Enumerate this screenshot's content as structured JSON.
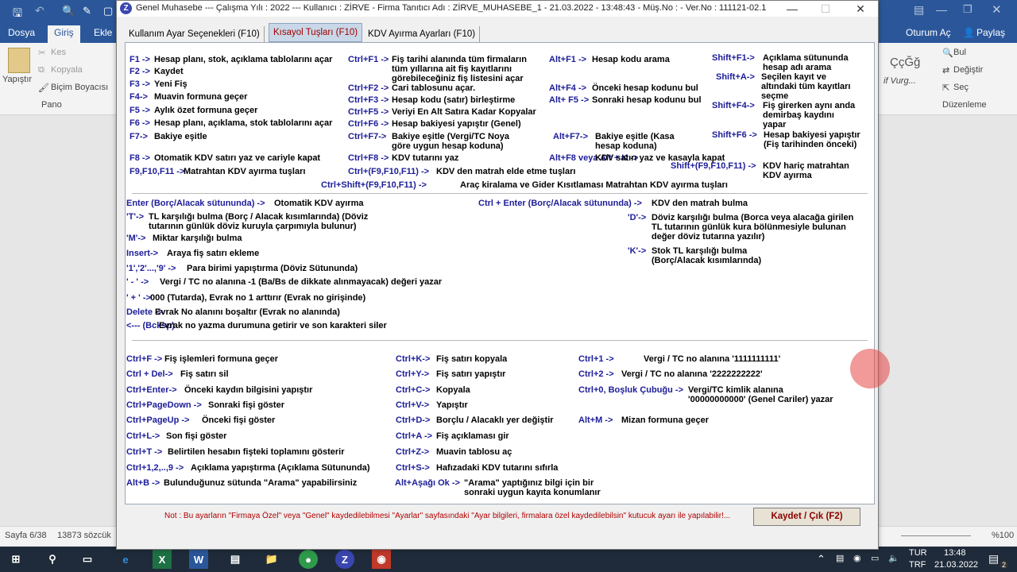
{
  "word": {
    "tabs": [
      "Dosya",
      "Giriş",
      "Ekle"
    ],
    "right_tabs": [
      "Oturum Aç",
      "Paylaş"
    ],
    "clipboard": {
      "paste": "Yapıştır",
      "cut": "Kes",
      "copy": "Kopyala",
      "format_painter": "Biçim Boyacısı",
      "group": "Pano"
    },
    "editing": {
      "find": "Bul",
      "replace": "Değiştir",
      "select": "Seç",
      "group": "Düzenleme"
    },
    "styles": {
      "a": "ÇçĞğ",
      "b": "if Vurg..."
    },
    "status": {
      "page": "Sayfa 6/38",
      "words": "13873 sözcük",
      "zoom": "%100"
    }
  },
  "taskbar": {
    "lang1": "TUR",
    "lang2": "TRF",
    "time": "13:48",
    "date": "21.03.2022",
    "notif": "2"
  },
  "app": {
    "title": "Genel Muhasebe  ---  Çalışma Yılı : 2022  ---  Kullanıcı : ZİRVE - Firma Tanıtıcı Adı : ZİRVE_MUHASEBE_1 - 21.03.2022 - 13:48:43 - Müş.No :  - Ver.No : 111121-02.1",
    "logo": "Z",
    "tabs": [
      "Kullanım Ayar Seçenekleri (F10)",
      "Kısayol Tuşları (F10)",
      "KDV Ayırma Ayarları  (F10)"
    ],
    "note": "Not : Bu ayarların \"Firmaya Özel\" veya \"Genel\" kaydedilebilmesi \"Ayarlar\" sayfasındaki \"Ayar bilgileri, firmalara özel kaydedilebilsin\" kutucuk ayarı ile yapılabilir!...",
    "save_button": "Kaydet / Çık (F2)"
  },
  "shortcuts": {
    "s1": [
      {
        "k": "F1 ->",
        "d": "Hesap planı, stok, açıklama tablolarını açar"
      },
      {
        "k": "F2 ->",
        "d": "Kaydet"
      },
      {
        "k": "F3 ->",
        "d": "Yeni Fiş"
      },
      {
        "k": "F4->",
        "d": "Muavin formuna geçer"
      },
      {
        "k": "F5 ->",
        "d": "Aylık özet formuna geçer"
      },
      {
        "k": "F6 ->",
        "d": "Hesap planı, açıklama, stok tablolarını açar"
      },
      {
        "k": "F7->",
        "d": "Bakiye eşitle"
      },
      {
        "k": "F8 ->",
        "d": "Otomatik KDV satırı yaz ve cariyle kapat"
      },
      {
        "k": "F9,F10,F11 ->",
        "d": "Matrahtan KDV ayırma tuşları"
      },
      {
        "k": "Ctrl+F1 ->",
        "d": "Fiş tarihi alanında tüm firmaların"
      },
      {
        "k": "",
        "d": "tüm yıllarına ait fiş kayıtlarını"
      },
      {
        "k": "",
        "d": "görebileceğiniz fiş listesini açar"
      },
      {
        "k": "Ctrl+F2 ->",
        "d": "Cari tablosunu açar."
      },
      {
        "k": "Ctrl+F3 ->",
        "d": "Hesap kodu (satır) birleştirme"
      },
      {
        "k": "Ctrl+F5 ->",
        "d": "Veriyi En Alt Satıra Kadar Kopyalar"
      },
      {
        "k": "Ctrl+F6 ->",
        "d": "Hesap bakiyesi yapıştır (Genel)"
      },
      {
        "k": "Ctrl+F7->",
        "d": "Bakiye eşitle (Vergi/TC Noya"
      },
      {
        "k": "",
        "d": "göre uygun hesap koduna)"
      },
      {
        "k": "Ctrl+F8 ->",
        "d": "KDV tutarını yaz"
      },
      {
        "k": "Ctrl+(F9,F10,F11) ->",
        "d": "KDV den matrah elde etme tuşları"
      },
      {
        "k": "Alt+F1 ->",
        "d": "Hesap kodu arama"
      },
      {
        "k": "Alt+F4 ->",
        "d": "Önceki hesap kodunu bul"
      },
      {
        "k": "Alt+ F5 ->",
        "d": "Sonraki hesap kodunu bul"
      },
      {
        "k": "Alt+F7->",
        "d": "Bakiye eşitle (Kasa"
      },
      {
        "k": "",
        "d": "hesap koduna)"
      },
      {
        "k": "Alt+F8 veya Alt + K ->",
        "d": "KDV satırı yaz ve kasayla kapat"
      },
      {
        "k": "Shift+F1->",
        "d": "Açıklama sütununda"
      },
      {
        "k": "",
        "d": "hesap adı arama"
      },
      {
        "k": "Shift+A->",
        "d": "Seçilen kayıt ve"
      },
      {
        "k": "",
        "d": "altındaki tüm kayıtları"
      },
      {
        "k": "",
        "d": "seçme"
      },
      {
        "k": "Shift+F4->",
        "d": "Fiş girerken aynı anda"
      },
      {
        "k": "",
        "d": "demirbaş kaydını"
      },
      {
        "k": "",
        "d": "yapar"
      },
      {
        "k": "Shift+F6 ->",
        "d": "Hesap bakiyesi yapıştır"
      },
      {
        "k": "",
        "d": "(Fiş tarihinden önceki)"
      },
      {
        "k": "Shift+(F9,F10,F11) ->",
        "d": "KDV hariç matrahtan"
      },
      {
        "k": "",
        "d": "KDV ayırma"
      },
      {
        "k": "Ctrl+Shift+(F9,F10,F11) ->",
        "d": "Araç kiralama ve Gider Kısıtlaması Matrahtan KDV ayırma tuşları"
      }
    ],
    "s2": [
      {
        "k": "Enter (Borç/Alacak sütununda) ->",
        "d": "Otomatik KDV ayırma"
      },
      {
        "k": "'T'->",
        "d": "TL karşılığı bulma (Borç / Alacak kısımlarında) (Döviz"
      },
      {
        "k": "",
        "d": "tutarının günlük döviz kuruyla çarpımıyla bulunur)"
      },
      {
        "k": "'M'->",
        "d": "Miktar karşılığı bulma"
      },
      {
        "k": "Insert->",
        "d": "Araya fiş satırı ekleme"
      },
      {
        "k": "'1','2'...,'9' ->",
        "d": "Para birimi yapıştırma (Döviz Sütununda)"
      },
      {
        "k": "' - ' ->",
        "d": "Vergi / TC no alanına -1 (Ba/Bs de dikkate alınmayacak) değeri yazar"
      },
      {
        "k": "' + ' ->",
        "d": "000 (Tutarda),  Evrak no 1 arttırır (Evrak no girişinde)"
      },
      {
        "k": "Delete ->",
        "d": "Evrak No alanını boşaltır (Evrak no alanında)"
      },
      {
        "k": "<--- (Bcksp)",
        "d": "Evrak no yazma durumuna getirir ve son karakteri siler"
      },
      {
        "k": "Ctrl + Enter (Borç/Alacak sütununda) ->",
        "d": "KDV den matrah bulma"
      },
      {
        "k": "'D'->",
        "d": "Döviz karşılığı bulma (Borca veya alacağa girilen"
      },
      {
        "k": "",
        "d": "TL tutarının günlük kura bölünmesiyle bulunan"
      },
      {
        "k": "",
        "d": "değer döviz tutarına yazılır)"
      },
      {
        "k": "'K'->",
        "d": "Stok TL karşılığı bulma"
      },
      {
        "k": "",
        "d": "(Borç/Alacak kısımlarında)"
      }
    ],
    "s3": [
      {
        "k": "Ctrl+F ->",
        "d": "Fiş işlemleri formuna geçer"
      },
      {
        "k": "Ctrl + Del->",
        "d": "Fiş satırı sil"
      },
      {
        "k": "Ctrl+Enter->",
        "d": "Önceki kaydın bilgisini yapıştır"
      },
      {
        "k": "Ctrl+PageDown ->",
        "d": "Sonraki fişi göster"
      },
      {
        "k": "Ctrl+PageUp ->",
        "d": "Önceki fişi göster"
      },
      {
        "k": "Ctrl+L->",
        "d": "Son fişi göster"
      },
      {
        "k": "Ctrl+T ->",
        "d": "Belirtilen hesabın fişteki toplamını gösterir"
      },
      {
        "k": "Ctrl+1,2,..,9 ->",
        "d": "Açıklama yapıştırma (Açıklama Sütununda)"
      },
      {
        "k": "Alt+B ->",
        "d": "Bulunduğunuz sütunda \"Arama\" yapabilirsiniz"
      },
      {
        "k": "Ctrl+K->",
        "d": "Fiş satırı kopyala"
      },
      {
        "k": "Ctrl+Y->",
        "d": "Fiş satırı yapıştır"
      },
      {
        "k": "Ctrl+C->",
        "d": "Kopyala"
      },
      {
        "k": "Ctrl+V->",
        "d": "Yapıştır"
      },
      {
        "k": "Ctrl+D->",
        "d": "Borçlu / Alacaklı yer değiştir"
      },
      {
        "k": "Ctrl+A ->",
        "d": "Fiş açıklaması gir"
      },
      {
        "k": "Ctrl+Z->",
        "d": "Muavin tablosu aç"
      },
      {
        "k": "Ctrl+S->",
        "d": "Hafızadaki KDV tutarını sıfırla"
      },
      {
        "k": "Alt+Aşağı Ok ->",
        "d": "\"Arama\" yaptığınız bilgi için bir"
      },
      {
        "k": "",
        "d": "sonraki uygun kayıta konumlanır"
      },
      {
        "k": "Ctrl+1 ->",
        "d": "Vergi / TC no alanına '1111111111'"
      },
      {
        "k": "Ctrl+2 ->",
        "d": "Vergi / TC no alanına '2222222222'"
      },
      {
        "k": "Ctrl+0, Boşluk Çubuğu ->",
        "d": "Vergi/TC kimlik alanına"
      },
      {
        "k": "",
        "d": "'00000000000' (Genel Cariler) yazar"
      },
      {
        "k": "Alt+M ->",
        "d": "Mizan formuna geçer"
      }
    ]
  }
}
